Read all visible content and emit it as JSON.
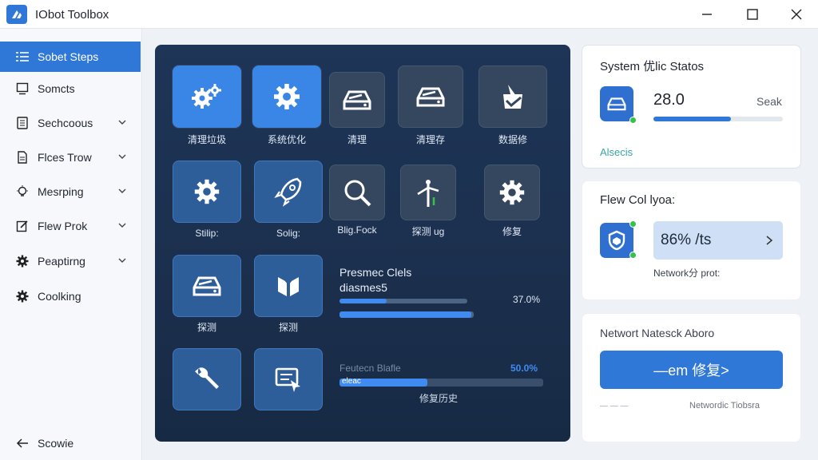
{
  "app": {
    "title": "IObot Toolbox"
  },
  "window": {
    "minimize_icon": "minimize-icon",
    "maximize_icon": "maximize-icon",
    "close_icon": "close-icon"
  },
  "sidebar": {
    "items": [
      {
        "label": "Sobet Steps",
        "icon": "list-icon",
        "active": true,
        "chevron": false
      },
      {
        "label": "Somcts",
        "icon": "monitor-icon",
        "active": false,
        "chevron": false
      },
      {
        "label": "Sechcoous",
        "icon": "document-icon",
        "active": false,
        "chevron": true
      },
      {
        "label": "Flces Trow",
        "icon": "file-icon",
        "active": false,
        "chevron": true
      },
      {
        "label": "Mesrping",
        "icon": "bulb-icon",
        "active": false,
        "chevron": true
      },
      {
        "label": "Flew Prok",
        "icon": "edit-icon",
        "active": false,
        "chevron": true
      },
      {
        "label": "Peaptirng",
        "icon": "gear-icon",
        "active": false,
        "chevron": true
      },
      {
        "label": "Coolking",
        "icon": "gear-icon",
        "active": false,
        "chevron": false
      }
    ],
    "footer": {
      "label": "Scowie",
      "icon": "back-arrow-icon"
    }
  },
  "tiles": [
    {
      "label": "清理垃圾",
      "icon": "gears-icon",
      "style": "bright"
    },
    {
      "label": "系统优化",
      "icon": "gear-icon",
      "style": "bright"
    },
    {
      "label": "清理",
      "icon": "drive-icon",
      "style": "dim"
    },
    {
      "label": "清理存",
      "icon": "drive-icon",
      "style": "dim"
    },
    {
      "label": "数据修",
      "icon": "box-check-icon",
      "style": "dim"
    },
    {
      "label": "Stilip:",
      "icon": "gear-icon",
      "style": "mid"
    },
    {
      "label": "Solig:",
      "icon": "rocket-icon",
      "style": "mid"
    },
    {
      "label": "Blig.Fock",
      "icon": "search-icon",
      "style": "dim"
    },
    {
      "label": "探测 ug",
      "icon": "antenna-icon",
      "style": "dim"
    },
    {
      "label": "修复",
      "icon": "gear-icon",
      "style": "dim"
    },
    {
      "label": "探测",
      "icon": "drive-icon",
      "style": "mid"
    },
    {
      "label": "探测",
      "icon": "shield-split-icon",
      "style": "mid"
    },
    {
      "label": "",
      "icon": "wrench-icon",
      "style": "mid"
    },
    {
      "label": "",
      "icon": "window-cursor-icon",
      "style": "mid"
    }
  ],
  "progress": [
    {
      "title": "Presmec Clels",
      "subtitle": "diasmes5",
      "pct_label": "37.0%",
      "fraction": 0.37
    },
    {
      "title": "",
      "subtitle": "",
      "pct_label": "",
      "fraction": 0.98
    },
    {
      "title": "Feutecn Blafle",
      "subtitle": "",
      "pct_label": "50.0%",
      "fraction": 0.43,
      "bar_text": "eleac",
      "caption": "修复历史"
    }
  ],
  "status_card": {
    "title": "System 优lic Statos",
    "value": "28.0",
    "right_label": "Seak",
    "fraction": 0.6,
    "footer": "Alsecis",
    "icon": "drive-icon"
  },
  "flow_card": {
    "title": "Flew Col lyoa:",
    "value": "86% /ts",
    "caption": "Network分 prot:",
    "icon": "shield-icon"
  },
  "network_card": {
    "title": "Networt Natesck Aboro",
    "button_label": "—em 修复>",
    "footer_left": "— — —",
    "footer_right": "Networdic Tiobsra"
  }
}
